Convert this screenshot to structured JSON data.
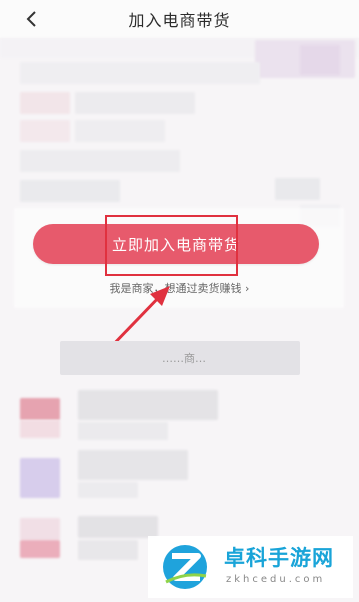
{
  "header": {
    "title": "加入电商带货",
    "back_icon": "chevron-left-icon"
  },
  "cta": {
    "label": "立即加入电商带货",
    "color": "#e75a6c",
    "highlight_color": "#e0313f"
  },
  "merchant_link": "我是商家，想通过卖货赚钱 ›",
  "section": {
    "heading": "……商…"
  },
  "watermark": {
    "name": "卓科手游网",
    "url": "zkhcedu.com",
    "logo_icon": "z-logo-icon",
    "color": "#19a4d8"
  }
}
